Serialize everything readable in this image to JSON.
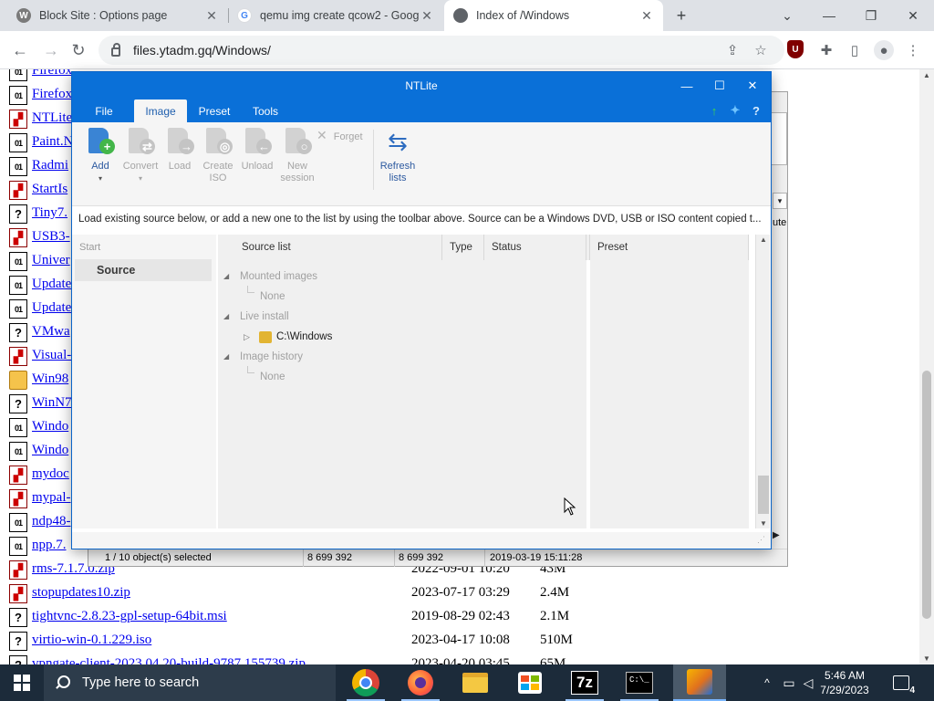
{
  "browser": {
    "tabs": [
      {
        "title": "Block Site : Options page",
        "icon": "block-site-icon",
        "color": "#7a7a7a",
        "glyph": "W",
        "close": "✕"
      },
      {
        "title": "qemu img create qcow2 - Googl",
        "icon": "google-icon",
        "color": "#4285f4",
        "glyph": "G",
        "close": "✕"
      },
      {
        "title": "Index of /Windows",
        "icon": "globe-icon",
        "color": "#5f6368",
        "glyph": "",
        "close": "✕"
      }
    ],
    "new_tab": "+",
    "url": "files.ytadm.gq/Windows/",
    "controls": {
      "tabsearch": "⌄",
      "minimize": "—",
      "restore": "❐",
      "close": "✕"
    },
    "nav": {
      "back": "←",
      "forward": "→",
      "reload": "↻"
    },
    "toolbar_icons": {
      "share": "⇪",
      "star": "☆",
      "ublock": "U",
      "extensions": "✚",
      "sidepanel": "▯",
      "profile": "●",
      "menu": "⋮"
    }
  },
  "listing": {
    "rows": [
      {
        "icon": "bin",
        "name": "Firefox",
        "date": "",
        "size": ""
      },
      {
        "icon": "bin",
        "name": "Firefox",
        "date": "",
        "size": ""
      },
      {
        "icon": "inst",
        "name": "NTLite",
        "date": "",
        "size": ""
      },
      {
        "icon": "bin",
        "name": "Paint.N",
        "date": "",
        "size": ""
      },
      {
        "icon": "bin",
        "name": "Radmi",
        "date": "",
        "size": ""
      },
      {
        "icon": "inst",
        "name": "StartIs",
        "date": "",
        "size": ""
      },
      {
        "icon": "unk",
        "name": "Tiny7.",
        "date": "",
        "size": ""
      },
      {
        "icon": "inst",
        "name": "USB3-",
        "date": "",
        "size": ""
      },
      {
        "icon": "bin",
        "name": "Univer",
        "date": "",
        "size": ""
      },
      {
        "icon": "bin",
        "name": "Update",
        "date": "",
        "size": ""
      },
      {
        "icon": "bin",
        "name": "Update",
        "date": "",
        "size": ""
      },
      {
        "icon": "unk",
        "name": "VMwa",
        "date": "",
        "size": ""
      },
      {
        "icon": "inst",
        "name": "Visual-",
        "date": "",
        "size": ""
      },
      {
        "icon": "folder",
        "name": "Win98",
        "date": "",
        "size": ""
      },
      {
        "icon": "unk",
        "name": "WinN7",
        "date": "",
        "size": ""
      },
      {
        "icon": "bin",
        "name": "Windo",
        "date": "",
        "size": ""
      },
      {
        "icon": "bin",
        "name": "Windo",
        "date": "",
        "size": ""
      },
      {
        "icon": "inst",
        "name": "mydoc",
        "date": "",
        "size": ""
      },
      {
        "icon": "inst",
        "name": "mypal-",
        "date": "",
        "size": ""
      },
      {
        "icon": "bin",
        "name": "ndp48-",
        "date": "",
        "size": ""
      },
      {
        "icon": "bin",
        "name": "npp.7.",
        "date": "",
        "size": ""
      },
      {
        "icon": "inst",
        "name": "rms-7.1.7.0.zip",
        "date": "2022-09-01 10:20",
        "size": "43M"
      },
      {
        "icon": "inst",
        "name": "stopupdates10.zip",
        "date": "2023-07-17 03:29",
        "size": "2.4M"
      },
      {
        "icon": "unk",
        "name": "tightvnc-2.8.23-gpl-setup-64bit.msi",
        "date": "2019-08-29 02:43",
        "size": "2.1M"
      },
      {
        "icon": "unk",
        "name": "virtio-win-0.1.229.iso",
        "date": "2023-04-17 10:08",
        "size": "510M"
      },
      {
        "icon": "unk",
        "name": "vpngate-client-2023.04.20-build-9787.155739.zip",
        "date": "2023-04-20 03:45",
        "size": "65M"
      }
    ]
  },
  "background_window": {
    "status": {
      "selected": "1 / 10 object(s) selected",
      "size": "8 699 392",
      "packed": "8 699 392",
      "modified": "2019-03-19 15:11:28"
    },
    "fragment": "ute"
  },
  "ntlite": {
    "title": "NTLite",
    "window_controls": {
      "minimize": "—",
      "maximize": "☐",
      "close": "✕"
    },
    "menu": [
      "File",
      "Image",
      "Preset",
      "Tools"
    ],
    "mini_icons": {
      "update": "↑",
      "twitter": "✦",
      "help": "?"
    },
    "ribbon": {
      "add": "Add",
      "add_arrow": "▾",
      "convert": "Convert",
      "convert_arrow": "▾",
      "load": "Load",
      "create_iso_1": "Create",
      "create_iso_2": "ISO",
      "unload": "Unload",
      "new_session_1": "New",
      "new_session_2": "session",
      "forget": "Forget",
      "forget_icon": "✕",
      "refresh_1": "Refresh",
      "refresh_2": "lists"
    },
    "info": "Load existing source below, or add a new one to the list by using the toolbar above. Source can be a Windows DVD, USB or ISO content copied t...",
    "left": {
      "header": "Start",
      "item": "Source"
    },
    "columns": {
      "source_list": "Source list",
      "type": "Type",
      "status": "Status",
      "preset": "Preset"
    },
    "tree": {
      "mounted": "Mounted images",
      "mounted_none": "None",
      "live": "Live install",
      "live_item": "C:\\Windows",
      "history": "Image history",
      "history_none": "None",
      "collapse_glyph": "◢",
      "expand_glyph": "▷"
    }
  },
  "taskbar": {
    "search_placeholder": "Type here to search",
    "apps": [
      "chrome-icon",
      "firefox-icon",
      "file-explorer-icon",
      "store-icon",
      "7zip-icon",
      "cmd-icon",
      "ntlite-icon"
    ],
    "sevenzip_label": "7z",
    "cmd_label": "C:\\_",
    "tray": {
      "chevron": "^",
      "network": "▭",
      "volume": "◁",
      "notifications": "4"
    },
    "time": "5:46 AM",
    "date": "7/29/2023"
  }
}
